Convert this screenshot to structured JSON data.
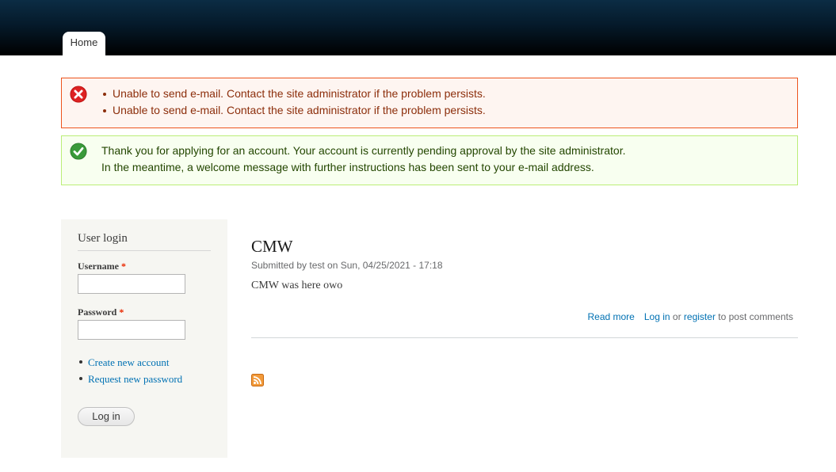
{
  "nav": {
    "home_label": "Home"
  },
  "messages": {
    "errors": [
      "Unable to send e-mail. Contact the site administrator if the problem persists.",
      "Unable to send e-mail. Contact the site administrator if the problem persists."
    ],
    "status_lines": [
      "Thank you for applying for an account. Your account is currently pending approval by the site administrator.",
      "In the meantime, a welcome message with further instructions has been sent to your e-mail address."
    ]
  },
  "login_block": {
    "title": "User login",
    "username_label": "Username",
    "password_label": "Password",
    "required_marker": "*",
    "username_value": "",
    "password_value": "",
    "links": [
      "Create new account",
      "Request new password"
    ],
    "submit_label": "Log in"
  },
  "node": {
    "title": "CMW",
    "submitted": "Submitted by test on Sun, 04/25/2021 - 17:18",
    "body": "CMW was here owo",
    "read_more": "Read more",
    "login_link": "Log in",
    "or_text": "or",
    "register_link": "register",
    "post_text": "to post comments"
  },
  "icons": {
    "error": "error-icon",
    "status": "check-icon",
    "feed": "rss-feed-icon"
  },
  "colors": {
    "header_top": "#0b2c44",
    "error_border": "#ed541d",
    "error_bg": "#fef5f1",
    "error_text": "#8c2e0b",
    "status_border": "#bbee77",
    "status_bg": "#f8fff0",
    "status_text": "#234600",
    "link": "#0071b3",
    "sidebar_bg": "#f6f6f2"
  }
}
